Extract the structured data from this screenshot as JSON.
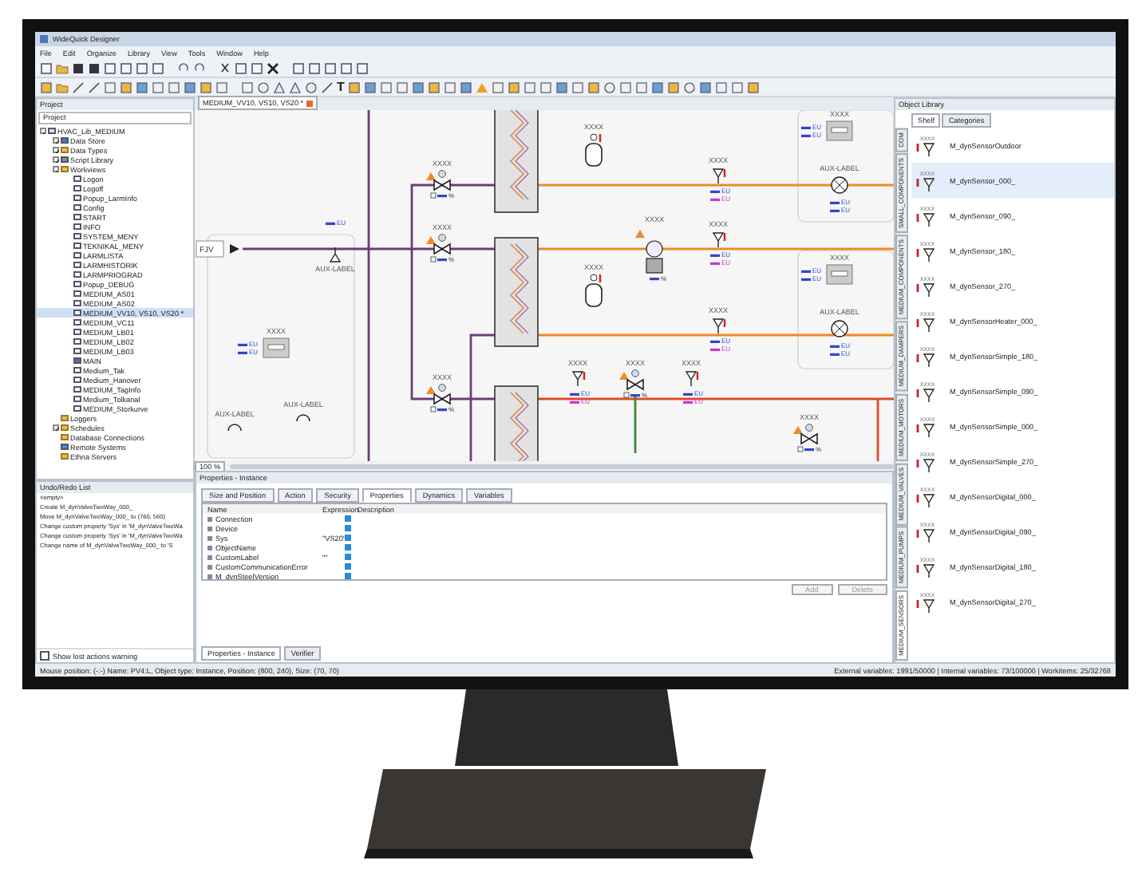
{
  "window": {
    "title": "WideQuick Designer"
  },
  "menu": [
    "File",
    "Edit",
    "Organize",
    "Library",
    "View",
    "Tools",
    "Window",
    "Help"
  ],
  "toolbar_text_tool": "T",
  "project": {
    "title": "Project",
    "dropdown": "Project",
    "tree": [
      {
        "label": "HVAC_Lib_MEDIUM",
        "kind": "project",
        "expanded": true,
        "selected": false,
        "children": [
          {
            "label": "Data Store",
            "kind": "store",
            "expanded": false,
            "selected": false
          },
          {
            "label": "Data Types",
            "kind": "folder",
            "expanded": false,
            "selected": false
          },
          {
            "label": "Script Library",
            "kind": "script",
            "expanded": false,
            "selected": false
          },
          {
            "label": "Workviews",
            "kind": "folder",
            "expanded": true,
            "selected": false,
            "children": [
              {
                "label": "Logon",
                "kind": "view",
                "selected": false
              },
              {
                "label": "Logoff",
                "kind": "view",
                "selected": false
              },
              {
                "label": "Popup_LarmInfo",
                "kind": "view",
                "selected": false
              },
              {
                "label": "Config",
                "kind": "view",
                "selected": false
              },
              {
                "label": "START",
                "kind": "view",
                "selected": false
              },
              {
                "label": "INFO",
                "kind": "view",
                "selected": false
              },
              {
                "label": "SYSTEM_MENY",
                "kind": "view",
                "selected": false
              },
              {
                "label": "TEKNIKAL_MENY",
                "kind": "view",
                "selected": false
              },
              {
                "label": "LARMLISTA",
                "kind": "view",
                "selected": false
              },
              {
                "label": "LARMHISTORIK",
                "kind": "view",
                "selected": false
              },
              {
                "label": "LARMPRIOGRAD",
                "kind": "view",
                "selected": false
              },
              {
                "label": "Popup_DEBUG",
                "kind": "view",
                "selected": false
              },
              {
                "label": "MEDIUM_AS01",
                "kind": "view",
                "selected": false
              },
              {
                "label": "MEDIUM_AS02",
                "kind": "view",
                "selected": false
              },
              {
                "label": "MEDIUM_VV10, VS10, VS20 *",
                "kind": "view",
                "selected": true
              },
              {
                "label": "MEDIUM_VC11",
                "kind": "view",
                "selected": false
              },
              {
                "label": "MEDIUM_LB01",
                "kind": "view",
                "selected": false
              },
              {
                "label": "MEDIUM_LB02",
                "kind": "view",
                "selected": false
              },
              {
                "label": "MEDIUM_LB03",
                "kind": "view",
                "selected": false
              },
              {
                "label": "MAIN",
                "kind": "main",
                "selected": false
              },
              {
                "label": "Medium_Tak",
                "kind": "view",
                "selected": false
              },
              {
                "label": "Medium_Hanover",
                "kind": "view",
                "selected": false
              },
              {
                "label": "MEDIUM_TagInfo",
                "kind": "view",
                "selected": false
              },
              {
                "label": "Medium_Tolkanal",
                "kind": "view",
                "selected": false
              },
              {
                "label": "MEDIUM_Storkurve",
                "kind": "view",
                "selected": false
              }
            ]
          },
          {
            "label": "Loggers",
            "kind": "folder",
            "selected": false
          },
          {
            "label": "Schedules",
            "kind": "folder",
            "expanded": false,
            "selected": false
          },
          {
            "label": "Database Connections",
            "kind": "folder",
            "selected": false
          },
          {
            "label": "Remote Systems",
            "kind": "remote",
            "selected": false
          },
          {
            "label": "Ethna Servers",
            "kind": "folder",
            "selected": false
          }
        ]
      }
    ]
  },
  "undo": {
    "title": "Undo/Redo List",
    "items": [
      "<empty>",
      "Create M_dynValveTwoWay_000_",
      "Move M_dynValveTwoWay_000_ to (760, 560)",
      "Change custom property 'Sys' in 'M_dynValveTwoWa",
      "Change custom property 'Sys' in 'M_dynValveTwoWa",
      "Change name of M_dynValveTwoWay_000_ to 'S"
    ],
    "warning": {
      "label": "Show lost actions warning",
      "checked": false
    }
  },
  "document": {
    "tab": "MEDIUM_VV10, VS10, VS20 *",
    "zoom": "100 %",
    "inlet": "FJV"
  },
  "diagram": {
    "nodes": [
      {
        "kind": "valve",
        "label": "XXXX",
        "unit": "%"
      },
      {
        "kind": "valve",
        "label": "XXXX",
        "unit": "%"
      },
      {
        "kind": "valve",
        "label": "XXXX",
        "unit": "%"
      },
      {
        "kind": "tank",
        "label": "XXXX"
      },
      {
        "kind": "tank",
        "label": "XXXX"
      },
      {
        "kind": "sensor",
        "label": "XXXX",
        "units": [
          {
            "text": "EU",
            "color": "#3344cc"
          },
          {
            "text": "EU",
            "color": "#cc33cc"
          }
        ]
      },
      {
        "kind": "sensor",
        "label": "XXXX",
        "units": [
          {
            "text": "EU",
            "color": "#3344cc"
          },
          {
            "text": "EU",
            "color": "#cc33cc"
          }
        ]
      },
      {
        "kind": "sensor",
        "label": "XXXX",
        "units": [
          {
            "text": "EU",
            "color": "#3344cc"
          },
          {
            "text": "EU",
            "color": "#cc33cc"
          }
        ]
      },
      {
        "kind": "motor",
        "label": "XXXX",
        "unit": "%"
      },
      {
        "kind": "display",
        "label": "XXXX",
        "units": [
          {
            "text": "EU",
            "color": "#3344cc"
          },
          {
            "text": "EU",
            "color": "#3344cc"
          }
        ]
      },
      {
        "kind": "fan",
        "label": "AUX-LABEL",
        "units": [
          {
            "text": "EU",
            "color": "#3344cc"
          },
          {
            "text": "EU",
            "color": "#3344cc"
          }
        ]
      },
      {
        "kind": "display",
        "label": "XXXX",
        "units": [
          {
            "text": "EU",
            "color": "#3344cc"
          },
          {
            "text": "EU",
            "color": "#3344cc"
          }
        ]
      },
      {
        "kind": "fan",
        "label": "AUX-LABEL",
        "units": [
          {
            "text": "EU",
            "color": "#3344cc"
          },
          {
            "text": "EU",
            "color": "#3344cc"
          }
        ]
      },
      {
        "kind": "sensor",
        "label": "XXXX",
        "units": [
          {
            "text": "EU",
            "color": "#3344cc"
          },
          {
            "text": "EU",
            "color": "#cc33cc"
          }
        ]
      },
      {
        "kind": "valve",
        "label": "XXXX",
        "unit": "%"
      },
      {
        "kind": "sensor",
        "label": "XXXX",
        "units": [
          {
            "text": "EU",
            "color": "#3344cc"
          },
          {
            "text": "EU",
            "color": "#cc33cc"
          }
        ]
      },
      {
        "kind": "display",
        "label": "XXXX",
        "units": [
          {
            "text": "EU",
            "color": "#3344cc"
          },
          {
            "text": "EU",
            "color": "#3344cc"
          }
        ]
      },
      {
        "kind": "aux",
        "label": "AUX-LABEL",
        "units": [
          {
            "text": "EU",
            "color": "#3344cc"
          }
        ]
      },
      {
        "kind": "aux_top",
        "label": "AUX-LABEL"
      },
      {
        "kind": "aux_top",
        "label": "AUX-LABEL"
      },
      {
        "kind": "valve",
        "label": "XXXX",
        "unit": "%"
      }
    ]
  },
  "properties": {
    "title": "Properties - Instance",
    "tabs": [
      {
        "label": "Size and Position",
        "selected": false
      },
      {
        "label": "Action",
        "selected": false
      },
      {
        "label": "Security",
        "selected": false
      },
      {
        "label": "Properties",
        "selected": true
      },
      {
        "label": "Dynamics",
        "selected": false
      },
      {
        "label": "Variables",
        "selected": false
      }
    ],
    "columns": [
      "Name",
      "Expression",
      "Description"
    ],
    "rows": [
      {
        "name": "Connection",
        "expression": ""
      },
      {
        "name": "Device",
        "expression": ""
      },
      {
        "name": "Sys",
        "expression": "\"VS20\""
      },
      {
        "name": "ObjectName",
        "expression": ""
      },
      {
        "name": "CustomLabel",
        "expression": "\"\""
      },
      {
        "name": "CustomCommunicationError",
        "expression": ""
      },
      {
        "name": "M_dynSteelVersion",
        "expression": ""
      }
    ],
    "buttons": [
      {
        "label": "Add",
        "disabled": true
      },
      {
        "label": "Delete",
        "disabled": true
      }
    ],
    "bottom_tabs": [
      {
        "label": "Properties - Instance",
        "selected": true
      },
      {
        "label": "Verifier",
        "selected": false
      }
    ]
  },
  "library": {
    "title": "Object Library",
    "tabs": [
      {
        "label": "Shelf",
        "selected": true
      },
      {
        "label": "Categories",
        "selected": false
      }
    ],
    "categories": [
      {
        "label": "COM",
        "selected": false
      },
      {
        "label": "SMALL_COMPONENTS",
        "selected": false
      },
      {
        "label": "MEDIUM_COMPONENTS",
        "selected": false
      },
      {
        "label": "MEDIUM_DAMPERS",
        "selected": false
      },
      {
        "label": "MEDIUM_MOTORS",
        "selected": false
      },
      {
        "label": "MEDIUM_VALVES",
        "selected": false
      },
      {
        "label": "MEDIUM_PUMPS",
        "selected": false
      },
      {
        "label": "MEDIUM_SENSORS",
        "selected": true
      }
    ],
    "items": [
      {
        "name": "M_dynSensorOutdoor",
        "caption": "XXXX",
        "selected": false
      },
      {
        "name": "M_dynSensor_000_",
        "caption": "XXXX",
        "selected": true
      },
      {
        "name": "M_dynSensor_090_",
        "caption": "XXXX",
        "selected": false
      },
      {
        "name": "M_dynSensor_180_",
        "caption": "XXXX",
        "selected": false
      },
      {
        "name": "M_dynSensor_270_",
        "caption": "XXXX",
        "selected": false
      },
      {
        "name": "M_dynSensorHeater_000_",
        "caption": "XXXX",
        "selected": false
      },
      {
        "name": "M_dynSensorSimple_180_",
        "caption": "XXXX",
        "selected": false
      },
      {
        "name": "M_dynSensorSimple_090_",
        "caption": "XXXX",
        "selected": false
      },
      {
        "name": "M_dynSensorSimple_000_",
        "caption": "XXXX",
        "selected": false
      },
      {
        "name": "M_dynSensorSimple_270_",
        "caption": "XXXX",
        "selected": false
      },
      {
        "name": "M_dynSensorDigital_000_",
        "caption": "XXXX",
        "selected": false
      },
      {
        "name": "M_dynSensorDigital_090_",
        "caption": "XXXX",
        "selected": false
      },
      {
        "name": "M_dynSensorDigital_180_",
        "caption": "XXXX",
        "selected": false
      },
      {
        "name": "M_dynSensorDigital_270_",
        "caption": "XXXX",
        "selected": false
      }
    ]
  },
  "status_bar": {
    "left": "Mouse position: (-:-)   Name: PV4:L, Object type: Instance, Position: (800, 240), Size: (70, 70)",
    "right": "External variables: 1991/50000 | Internal variables: 73/100000 | Workitems: 25/32768"
  }
}
